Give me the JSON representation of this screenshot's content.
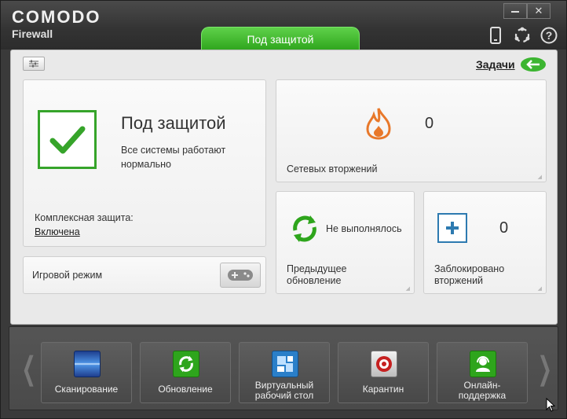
{
  "header": {
    "logo": "COMODO",
    "product": "Firewall",
    "status_tab": "Под защитой",
    "minimize": "▬",
    "close": "✕",
    "icons": [
      "mobile-icon",
      "sync-icon",
      "help-icon"
    ]
  },
  "toolbar": {
    "tasks_label": "Задачи"
  },
  "status_card": {
    "title": "Под защитой",
    "description": "Все системы работают нормально",
    "protection_label": "Комплексная защита:",
    "protection_value": "Включена"
  },
  "game_mode": {
    "label": "Игровой режим"
  },
  "network": {
    "count": "0",
    "label": "Сетевых вторжений"
  },
  "update": {
    "status": "Не выполнялось",
    "label_line1": "Предыдущее",
    "label_line2": "обновление"
  },
  "blocked": {
    "count": "0",
    "label_line1": "Заблокировано",
    "label_line2": "вторжений"
  },
  "tiles": [
    {
      "label_line1": "Сканирование",
      "label_line2": "",
      "icon": "scan-icon"
    },
    {
      "label_line1": "Обновление",
      "label_line2": "",
      "icon": "update-icon"
    },
    {
      "label_line1": "Виртуальный",
      "label_line2": "рабочий стол",
      "icon": "virtual-desktop-icon"
    },
    {
      "label_line1": "Карантин",
      "label_line2": "",
      "icon": "quarantine-icon"
    },
    {
      "label_line1": "Онлайн-",
      "label_line2": "поддержка",
      "icon": "support-icon"
    }
  ],
  "colors": {
    "accent_green": "#2ea51c",
    "fire_orange": "#e8782a",
    "blue": "#2d7ab0"
  }
}
